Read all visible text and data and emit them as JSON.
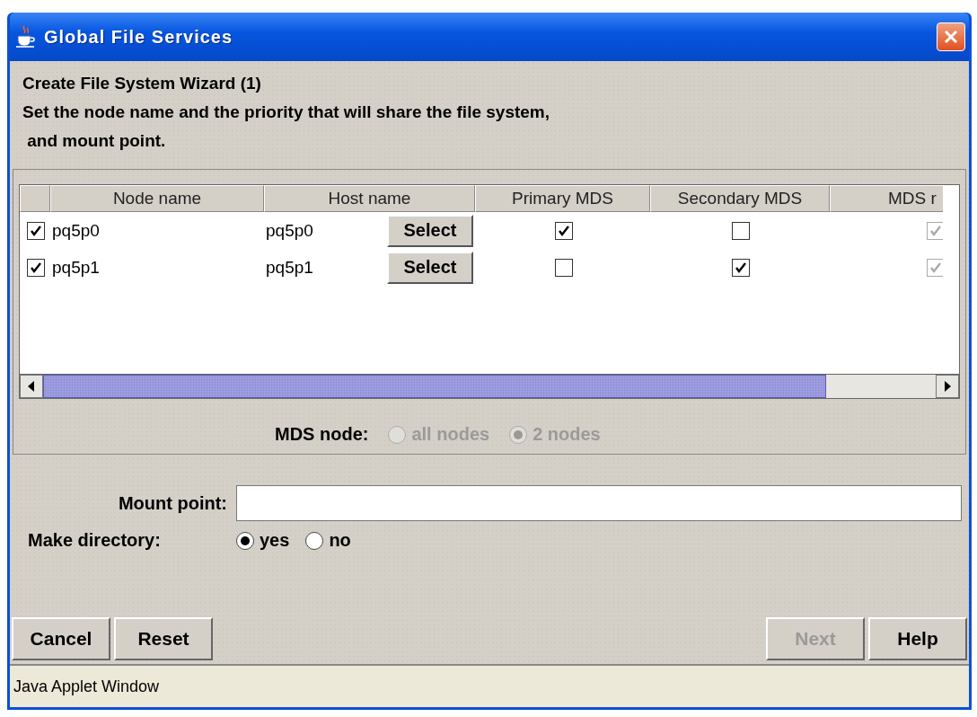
{
  "window": {
    "title": "Global File Services"
  },
  "wizard": {
    "heading": "Create File System Wizard (1)",
    "description_lines": [
      "Set the node name and the priority that will share the file system,",
      " and mount point."
    ]
  },
  "table": {
    "columns": [
      "Node name",
      "Host name",
      "Primary MDS",
      "Secondary MDS",
      "MDS r"
    ],
    "rows": [
      {
        "checked": true,
        "node_name": "pq5p0",
        "host_name": "pq5p0",
        "select_button": "Select",
        "primary_mds": true,
        "secondary_mds": false,
        "column_6": true,
        "column_6_disabled": true
      },
      {
        "checked": true,
        "node_name": "pq5p1",
        "host_name": "pq5p1",
        "select_button": "Select",
        "primary_mds": false,
        "secondary_mds": true,
        "column_6": true,
        "column_6_disabled": true
      }
    ]
  },
  "mds_node": {
    "label": "MDS node:",
    "options": [
      {
        "label": "all nodes",
        "selected": false,
        "disabled": true
      },
      {
        "label": "2 nodes",
        "selected": true,
        "disabled": true
      }
    ]
  },
  "mount_point": {
    "label": "Mount point:"
  },
  "make_directory": {
    "label": "Make directory:",
    "options": [
      {
        "label": "yes",
        "selected": true,
        "disabled": false
      },
      {
        "label": "no",
        "selected": false,
        "disabled": false
      }
    ]
  },
  "left_buttons": [
    {
      "label": "Cancel",
      "disabled": false
    },
    {
      "label": "Reset",
      "disabled": false
    }
  ],
  "right_buttons": [
    {
      "label": "Next",
      "disabled": true
    },
    {
      "label": "Help",
      "disabled": false
    }
  ],
  "status_bar": "Java Applet Window"
}
